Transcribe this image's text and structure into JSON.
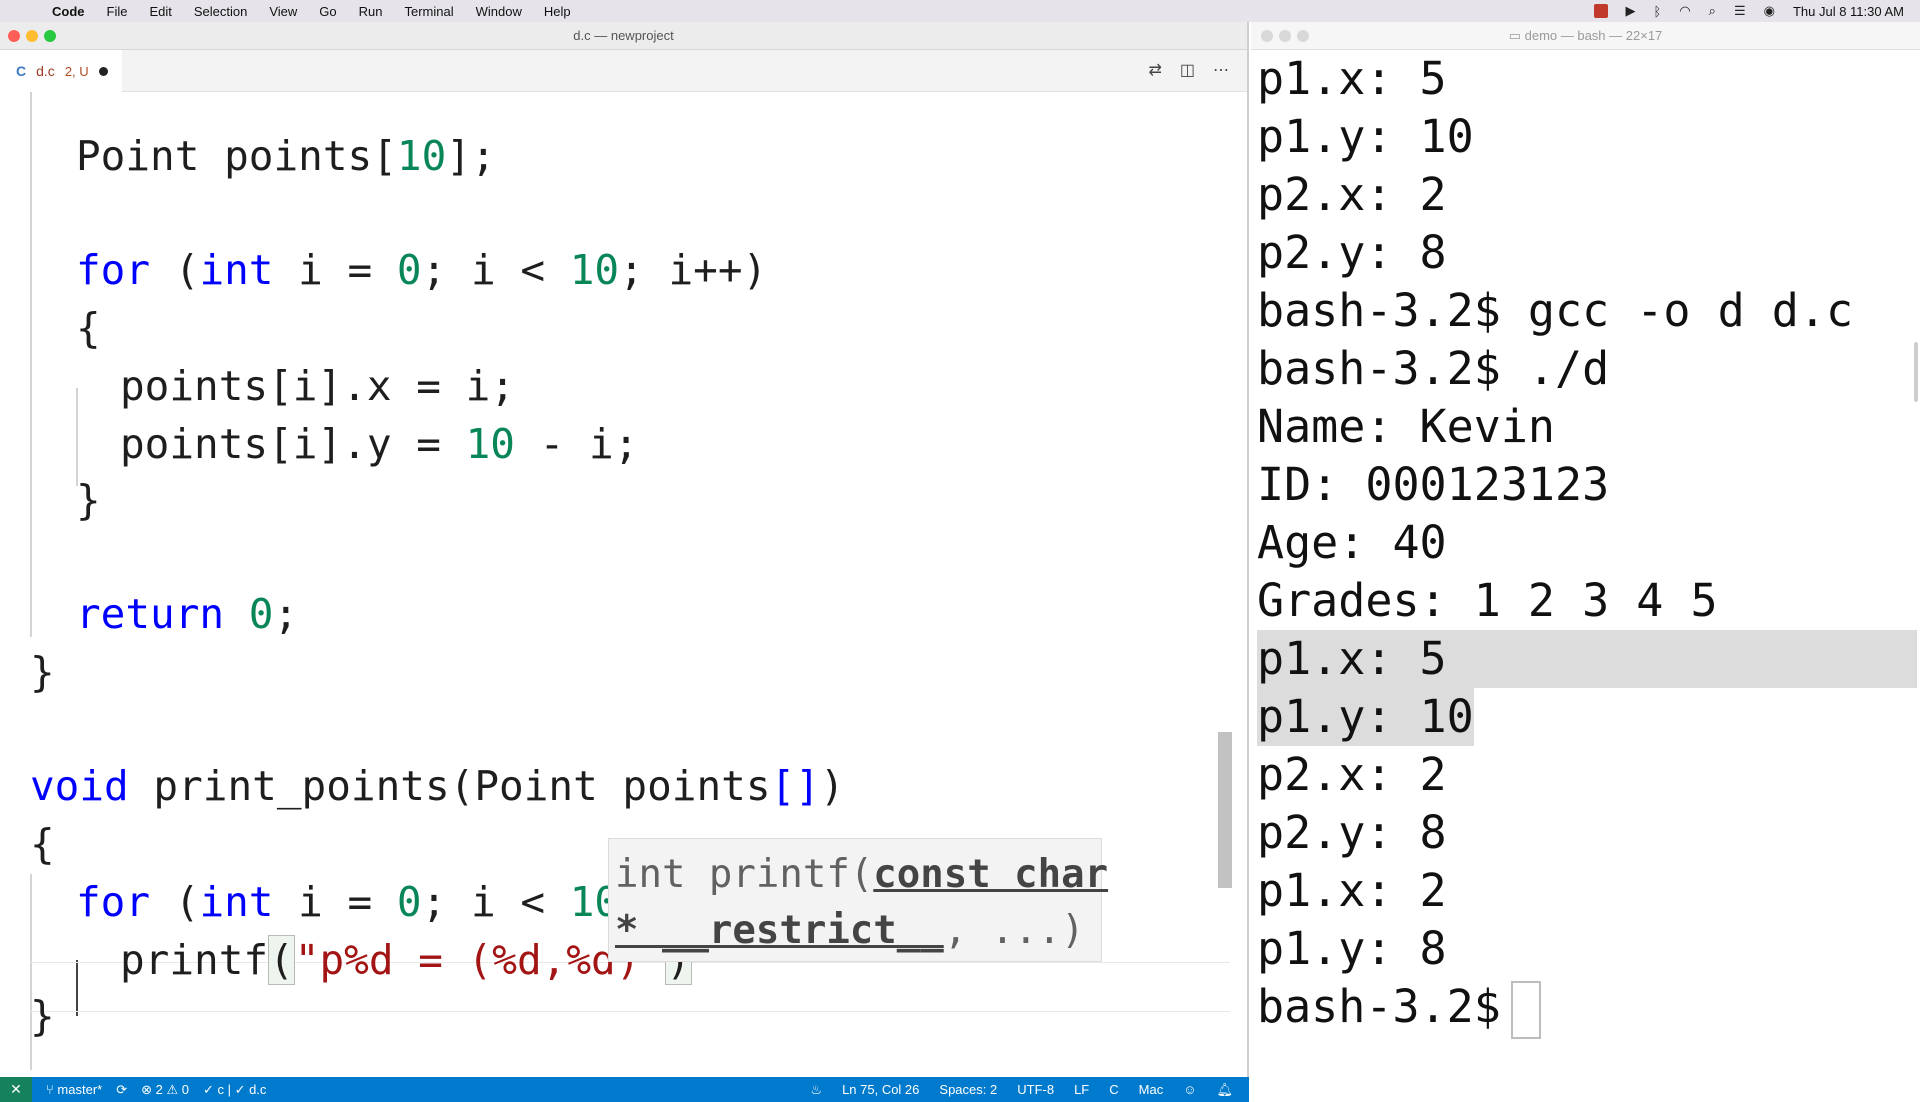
{
  "menubar": {
    "app": "Code",
    "items": [
      "File",
      "Edit",
      "Selection",
      "View",
      "Go",
      "Run",
      "Terminal",
      "Window",
      "Help"
    ],
    "clock": "Thu Jul 8  11:30 AM"
  },
  "editor": {
    "window_title": "d.c — newproject",
    "tab": {
      "icon": "C",
      "filename": "d.c",
      "status": "2, U"
    },
    "code_lines": [
      {
        "parts": [
          [
            "",
            "Point points["
          ],
          [
            "num",
            "10"
          ],
          [
            "",
            "];"
          ]
        ]
      },
      {
        "parts": [
          [
            "kw",
            "for"
          ],
          [
            "",
            " ("
          ],
          [
            "ty",
            "int"
          ],
          [
            "",
            " i = "
          ],
          [
            "num",
            "0"
          ],
          [
            "",
            "; i < "
          ],
          [
            "num",
            "10"
          ],
          [
            "",
            "; i++)"
          ]
        ]
      },
      {
        "parts": [
          [
            "",
            "{"
          ]
        ]
      },
      {
        "parts": [
          [
            "",
            "points[i].x = i;"
          ]
        ]
      },
      {
        "parts": [
          [
            "",
            "points[i].y = "
          ],
          [
            "num",
            "10"
          ],
          [
            "",
            " - i;"
          ]
        ]
      },
      {
        "parts": [
          [
            "",
            "}"
          ]
        ]
      },
      {
        "parts": [
          [
            "kw",
            "return"
          ],
          [
            "",
            " "
          ],
          [
            "num",
            "0"
          ],
          [
            "",
            ";"
          ]
        ]
      },
      {
        "parts": [
          [
            "",
            "}"
          ]
        ]
      },
      {
        "parts": [
          [
            "ty",
            "void"
          ],
          [
            "",
            " print_points(Point points"
          ],
          [
            "kw",
            "[]"
          ],
          [
            "",
            ")"
          ]
        ]
      },
      {
        "parts": [
          [
            "",
            "{"
          ]
        ]
      },
      {
        "parts": [
          [
            "kw",
            "for"
          ],
          [
            "",
            " ("
          ],
          [
            "ty",
            "int"
          ],
          [
            "",
            " i = "
          ],
          [
            "num",
            "0"
          ],
          [
            "",
            "; i < "
          ],
          [
            "num",
            "10"
          ],
          [
            "",
            ";"
          ]
        ]
      },
      {
        "parts": [
          [
            "",
            "printf"
          ],
          [
            "br",
            "("
          ],
          [
            "str",
            "\"p%d = (%d,%d)\""
          ],
          [
            "br",
            ")"
          ]
        ]
      },
      {
        "parts": [
          [
            "",
            "}"
          ]
        ]
      }
    ],
    "tooltip": {
      "line1_pre": "int printf(",
      "line1_param": "const char",
      "line2_param": "* __restrict__",
      "line2_post": ", ...)"
    }
  },
  "statusbar": {
    "branch": "master*",
    "problems": "⊗ 2 ⚠ 0",
    "check": "✓ c | ✓ d.c",
    "position": "Ln 75, Col 26",
    "spaces": "Spaces: 2",
    "encoding": "UTF-8",
    "eol": "LF",
    "language": "C",
    "platform": "Mac"
  },
  "terminal": {
    "window_title": "demo — bash — 22×17",
    "lines": [
      "p1.x: 5",
      "p1.y: 10",
      "p2.x: 2",
      "p2.y: 8",
      "bash-3.2$ gcc -o d d.c",
      "bash-3.2$ ./d",
      "Name: Kevin",
      "ID: 000123123",
      "Age: 40",
      "Grades: 1 2 3 4 5",
      "p1.x: 5",
      "p1.y: 10",
      "p2.x: 2",
      "p2.y: 8",
      "p1.x: 2",
      "p1.y: 8"
    ],
    "prompt": "bash-3.2$"
  },
  "colors": {
    "statusbar_bg": "#007acc",
    "remote_bg": "#16825d",
    "keyword": "#0000ff",
    "number": "#098658",
    "string": "#a31515"
  }
}
